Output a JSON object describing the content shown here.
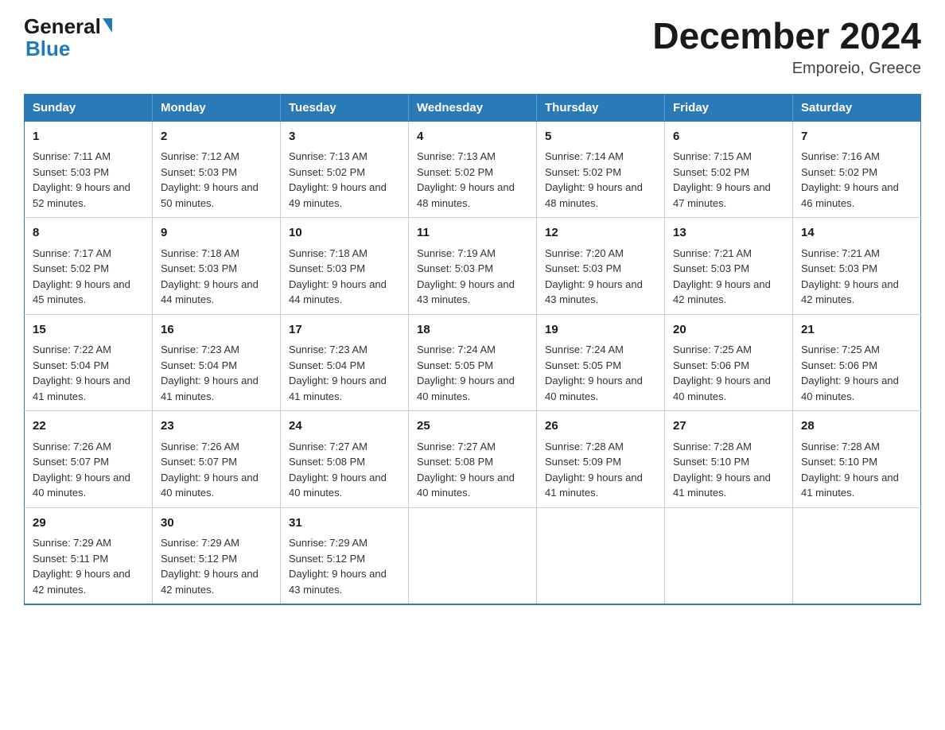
{
  "header": {
    "title": "December 2024",
    "subtitle": "Emporeio, Greece",
    "logo_general": "General",
    "logo_blue": "Blue"
  },
  "columns": [
    "Sunday",
    "Monday",
    "Tuesday",
    "Wednesday",
    "Thursday",
    "Friday",
    "Saturday"
  ],
  "weeks": [
    [
      {
        "day": 1,
        "sunrise": "7:11 AM",
        "sunset": "5:03 PM",
        "daylight": "9 hours and 52 minutes."
      },
      {
        "day": 2,
        "sunrise": "7:12 AM",
        "sunset": "5:03 PM",
        "daylight": "9 hours and 50 minutes."
      },
      {
        "day": 3,
        "sunrise": "7:13 AM",
        "sunset": "5:02 PM",
        "daylight": "9 hours and 49 minutes."
      },
      {
        "day": 4,
        "sunrise": "7:13 AM",
        "sunset": "5:02 PM",
        "daylight": "9 hours and 48 minutes."
      },
      {
        "day": 5,
        "sunrise": "7:14 AM",
        "sunset": "5:02 PM",
        "daylight": "9 hours and 48 minutes."
      },
      {
        "day": 6,
        "sunrise": "7:15 AM",
        "sunset": "5:02 PM",
        "daylight": "9 hours and 47 minutes."
      },
      {
        "day": 7,
        "sunrise": "7:16 AM",
        "sunset": "5:02 PM",
        "daylight": "9 hours and 46 minutes."
      }
    ],
    [
      {
        "day": 8,
        "sunrise": "7:17 AM",
        "sunset": "5:02 PM",
        "daylight": "9 hours and 45 minutes."
      },
      {
        "day": 9,
        "sunrise": "7:18 AM",
        "sunset": "5:03 PM",
        "daylight": "9 hours and 44 minutes."
      },
      {
        "day": 10,
        "sunrise": "7:18 AM",
        "sunset": "5:03 PM",
        "daylight": "9 hours and 44 minutes."
      },
      {
        "day": 11,
        "sunrise": "7:19 AM",
        "sunset": "5:03 PM",
        "daylight": "9 hours and 43 minutes."
      },
      {
        "day": 12,
        "sunrise": "7:20 AM",
        "sunset": "5:03 PM",
        "daylight": "9 hours and 43 minutes."
      },
      {
        "day": 13,
        "sunrise": "7:21 AM",
        "sunset": "5:03 PM",
        "daylight": "9 hours and 42 minutes."
      },
      {
        "day": 14,
        "sunrise": "7:21 AM",
        "sunset": "5:03 PM",
        "daylight": "9 hours and 42 minutes."
      }
    ],
    [
      {
        "day": 15,
        "sunrise": "7:22 AM",
        "sunset": "5:04 PM",
        "daylight": "9 hours and 41 minutes."
      },
      {
        "day": 16,
        "sunrise": "7:23 AM",
        "sunset": "5:04 PM",
        "daylight": "9 hours and 41 minutes."
      },
      {
        "day": 17,
        "sunrise": "7:23 AM",
        "sunset": "5:04 PM",
        "daylight": "9 hours and 41 minutes."
      },
      {
        "day": 18,
        "sunrise": "7:24 AM",
        "sunset": "5:05 PM",
        "daylight": "9 hours and 40 minutes."
      },
      {
        "day": 19,
        "sunrise": "7:24 AM",
        "sunset": "5:05 PM",
        "daylight": "9 hours and 40 minutes."
      },
      {
        "day": 20,
        "sunrise": "7:25 AM",
        "sunset": "5:06 PM",
        "daylight": "9 hours and 40 minutes."
      },
      {
        "day": 21,
        "sunrise": "7:25 AM",
        "sunset": "5:06 PM",
        "daylight": "9 hours and 40 minutes."
      }
    ],
    [
      {
        "day": 22,
        "sunrise": "7:26 AM",
        "sunset": "5:07 PM",
        "daylight": "9 hours and 40 minutes."
      },
      {
        "day": 23,
        "sunrise": "7:26 AM",
        "sunset": "5:07 PM",
        "daylight": "9 hours and 40 minutes."
      },
      {
        "day": 24,
        "sunrise": "7:27 AM",
        "sunset": "5:08 PM",
        "daylight": "9 hours and 40 minutes."
      },
      {
        "day": 25,
        "sunrise": "7:27 AM",
        "sunset": "5:08 PM",
        "daylight": "9 hours and 40 minutes."
      },
      {
        "day": 26,
        "sunrise": "7:28 AM",
        "sunset": "5:09 PM",
        "daylight": "9 hours and 41 minutes."
      },
      {
        "day": 27,
        "sunrise": "7:28 AM",
        "sunset": "5:10 PM",
        "daylight": "9 hours and 41 minutes."
      },
      {
        "day": 28,
        "sunrise": "7:28 AM",
        "sunset": "5:10 PM",
        "daylight": "9 hours and 41 minutes."
      }
    ],
    [
      {
        "day": 29,
        "sunrise": "7:29 AM",
        "sunset": "5:11 PM",
        "daylight": "9 hours and 42 minutes."
      },
      {
        "day": 30,
        "sunrise": "7:29 AM",
        "sunset": "5:12 PM",
        "daylight": "9 hours and 42 minutes."
      },
      {
        "day": 31,
        "sunrise": "7:29 AM",
        "sunset": "5:12 PM",
        "daylight": "9 hours and 43 minutes."
      },
      null,
      null,
      null,
      null
    ]
  ]
}
